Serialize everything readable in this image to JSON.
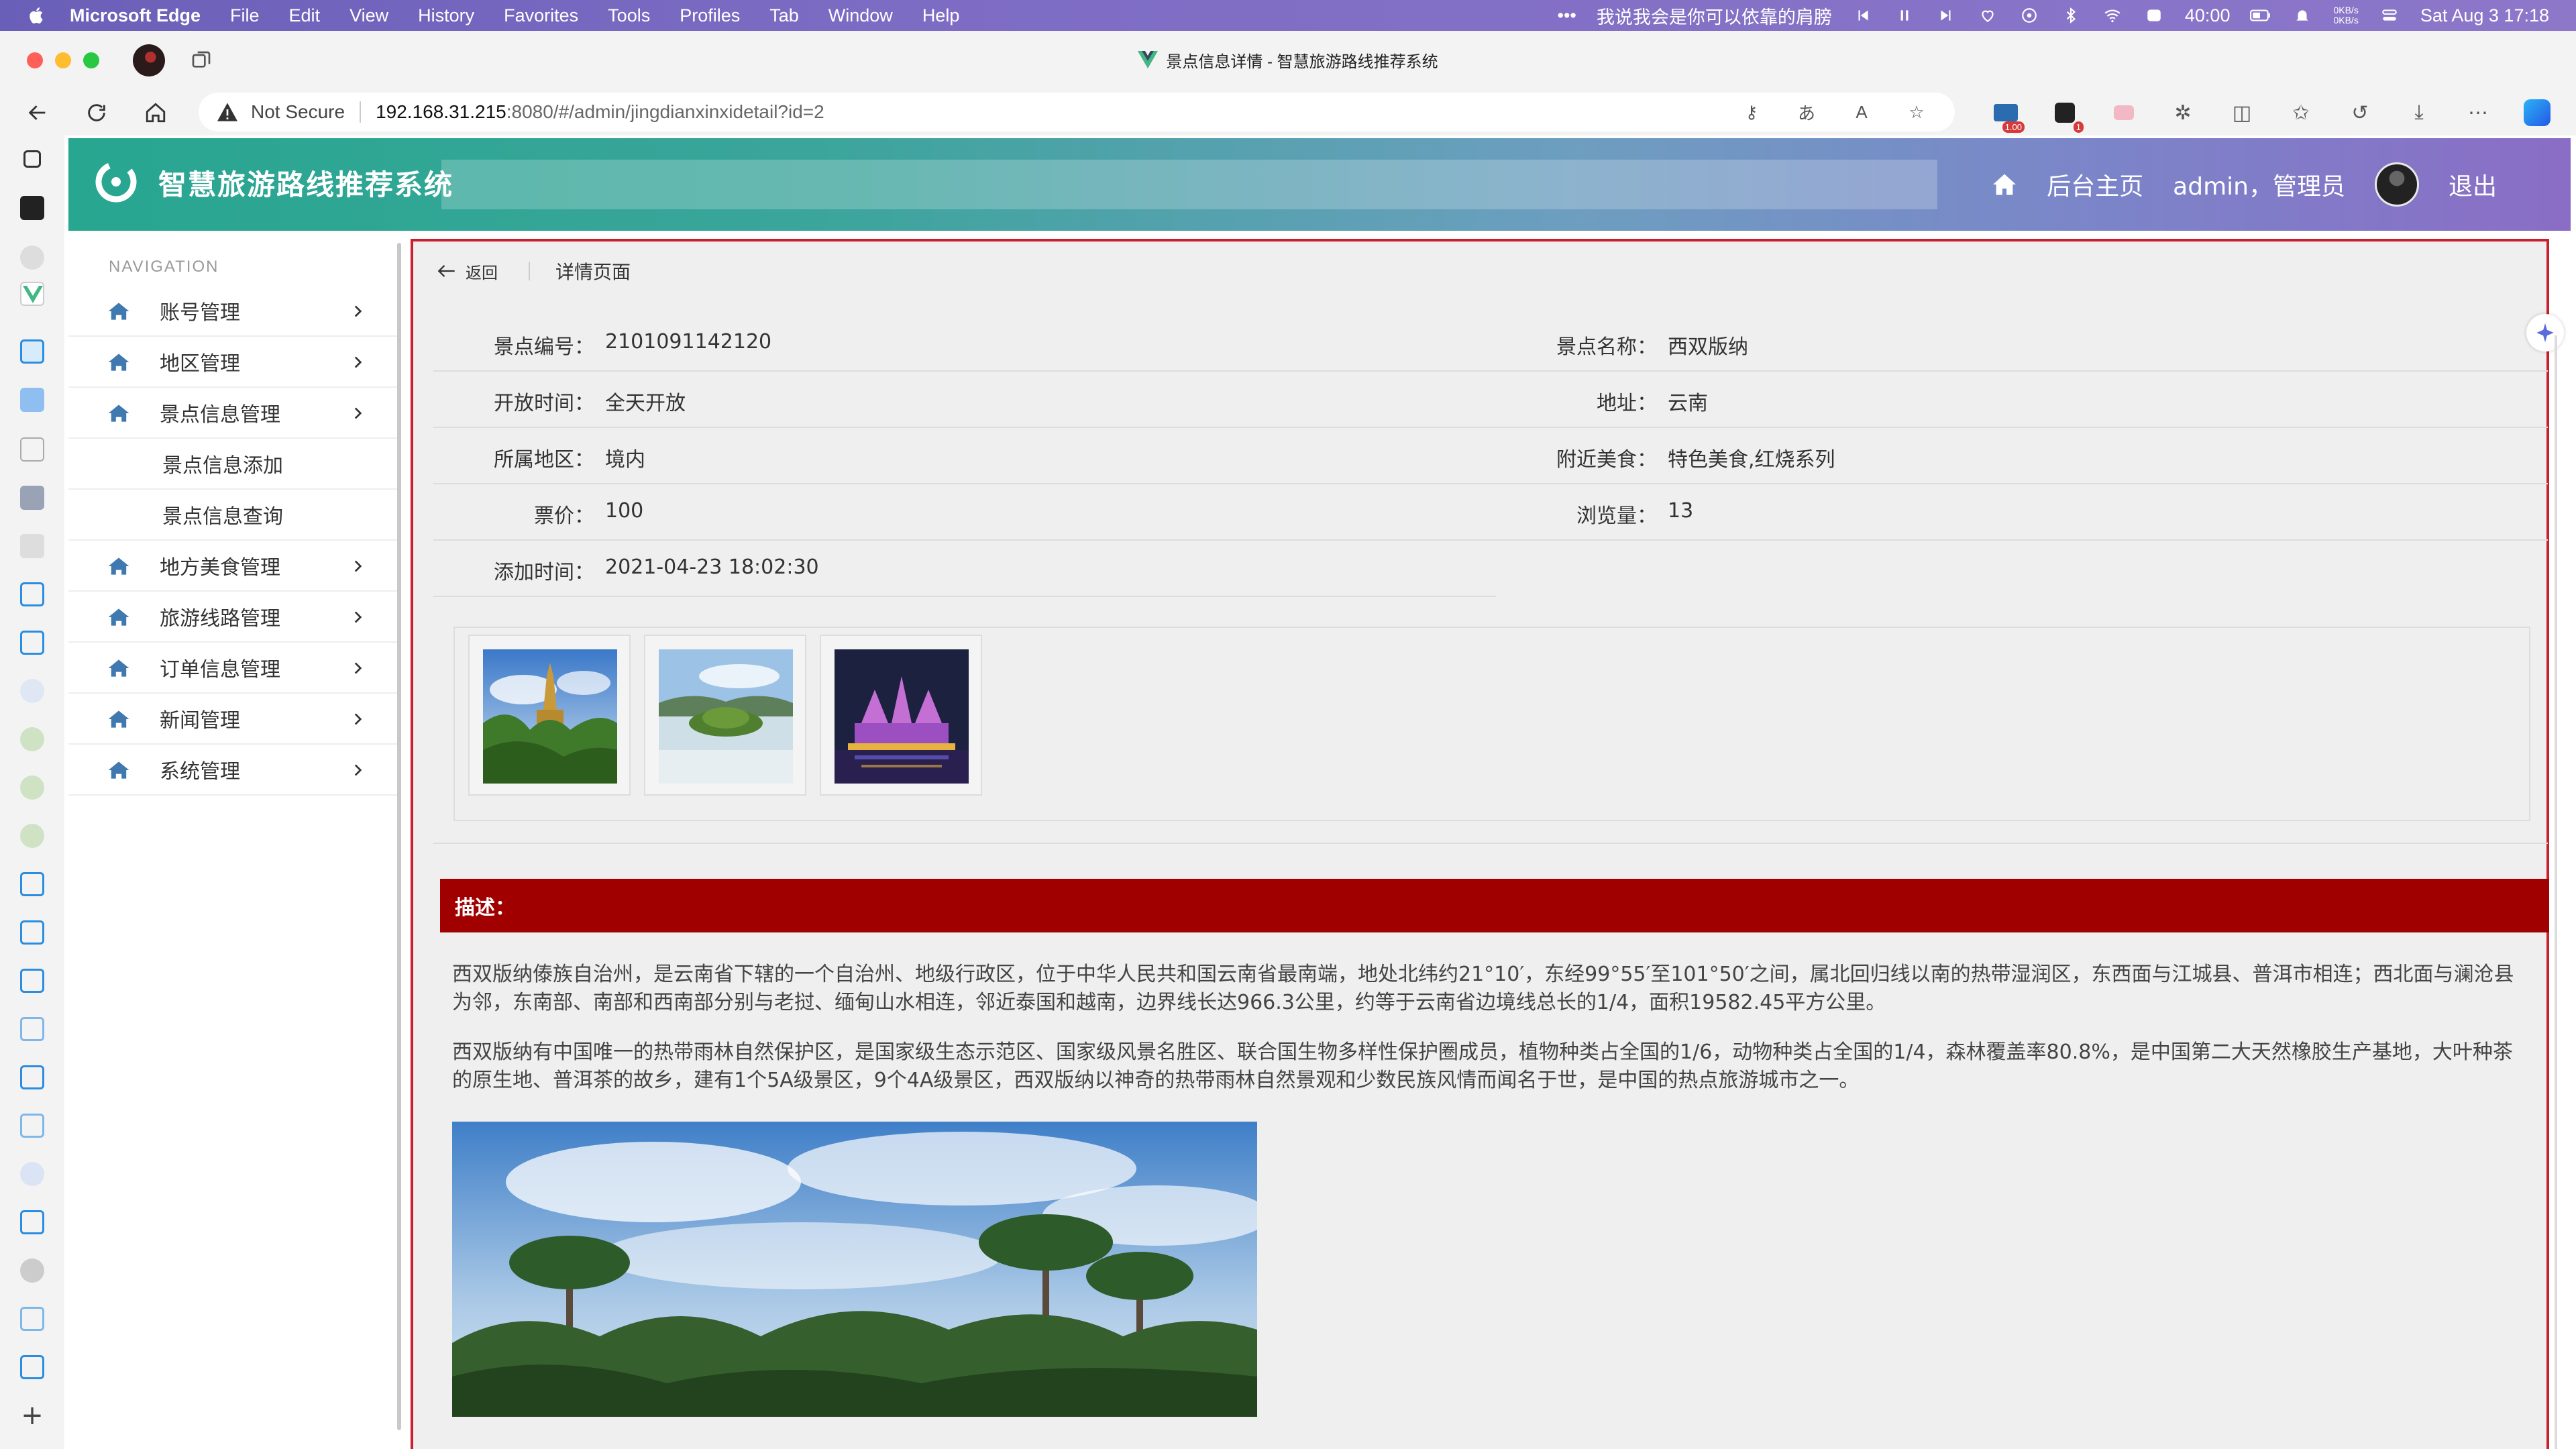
{
  "menubar": {
    "app": "Microsoft Edge",
    "menus": [
      "File",
      "Edit",
      "View",
      "History",
      "Favorites",
      "Tools",
      "Profiles",
      "Tab",
      "Window",
      "Help"
    ],
    "now_playing": "我说我会是你可以依靠的肩膀",
    "battery": "40:00",
    "net_up": "0KB/s",
    "net_down": "0KB/s",
    "datetime": "Sat Aug 3  17:18"
  },
  "browser": {
    "tab_title": "景点信息详情 - 智慧旅游路线推荐系统",
    "not_secure": "Not Secure",
    "url_host": "192.168.31.215",
    "url_path": ":8080/#/admin/jingdianxinxidetail?id=2",
    "ext_badge": "1.00",
    "ext_badge2": "1"
  },
  "header": {
    "title": "智慧旅游路线推荐系统",
    "home_label": "后台主页",
    "user_label": "admin，管理员",
    "logout_label": "退出"
  },
  "nav": {
    "heading": "NAVIGATION",
    "items": [
      {
        "label": "账号管理"
      },
      {
        "label": "地区管理"
      },
      {
        "label": "景点信息管理"
      }
    ],
    "sub_items": [
      {
        "label": "景点信息添加"
      },
      {
        "label": "景点信息查询"
      }
    ],
    "items_after": [
      {
        "label": "地方美食管理"
      },
      {
        "label": "旅游线路管理"
      },
      {
        "label": "订单信息管理"
      },
      {
        "label": "新闻管理"
      },
      {
        "label": "系统管理"
      }
    ]
  },
  "detail": {
    "back_label": "返回",
    "page_title": "详情页面",
    "fields": {
      "code_k": "景点编号：",
      "code_v": "2101091142120",
      "name_k": "景点名称：",
      "name_v": "西双版纳",
      "open_k": "开放时间：",
      "open_v": "全天开放",
      "addr_k": "地址：",
      "addr_v": "云南",
      "region_k": "所属地区：",
      "region_v": "境内",
      "food_k": "附近美食：",
      "food_v": "特色美食,红烧系列",
      "price_k": "票价：",
      "price_v": "100",
      "views_k": "浏览量：",
      "views_v": "13",
      "added_k": "添加时间：",
      "added_v": "2021-04-23 18:02:30"
    },
    "desc_label": "描述：",
    "desc_p1": "西双版纳傣族自治州，是云南省下辖的一个自治州、地级行政区，位于中华人民共和国云南省最南端，地处北纬约21°10′，东经99°55′至101°50′之间，属北回归线以南的热带湿润区，东西面与江城县、普洱市相连；西北面与澜沧县为邻，东南部、南部和西南部分别与老挝、缅甸山水相连，邻近泰国和越南，边界线长达966.3公里，约等于云南省边境线总长的1/4，面积19582.45平方公里。",
    "desc_p2": "西双版纳有中国唯一的热带雨林自然保护区，是国家级生态示范区、国家级风景名胜区、联合国生物多样性保护圈成员，植物种类占全国的1/6，动物种类占全国的1/4，森林覆盖率80.8%，是中国第二大天然橡胶生产基地，大叶种茶的原生地、普洱茶的故乡，建有1个5A级景区，9个4A级景区，西双版纳以神奇的热带雨林自然景观和少数民族风情而闻名于世，是中国的热点旅游城市之一。"
  }
}
